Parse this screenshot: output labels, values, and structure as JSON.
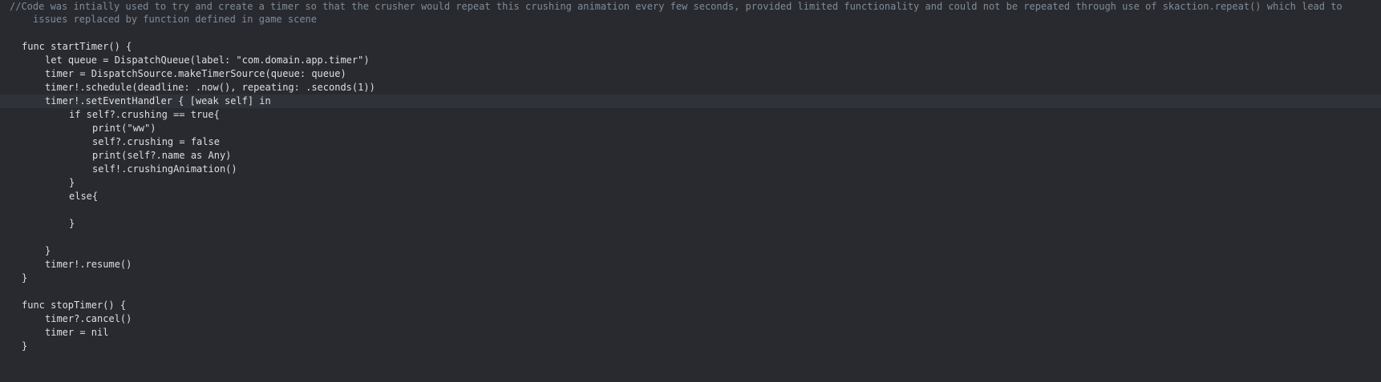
{
  "editor": {
    "lines": [
      {
        "text": "//Code was intially used to try and create a timer so that the crusher would repeat this crushing animation every few seconds, provided limited functionality and could not be repeated through use of skaction.repeat() which lead to"
      },
      {
        "text": "issues replaced by function defined in game scene"
      },
      {
        "text": ""
      },
      {
        "text": "func startTimer() {"
      },
      {
        "text": "let queue = DispatchQueue(label: \"com.domain.app.timer\")"
      },
      {
        "text": "timer = DispatchSource.makeTimerSource(queue: queue)"
      },
      {
        "text": "timer!.schedule(deadline: .now(), repeating: .seconds(1))"
      },
      {
        "text": "timer!.setEventHandler { [weak self] in"
      },
      {
        "text": "if self?.crushing == true{"
      },
      {
        "text": "print(\"ww\")"
      },
      {
        "text": "self?.crushing = false"
      },
      {
        "text": "print(self?.name as Any)"
      },
      {
        "text": "self!.crushingAnimation()"
      },
      {
        "text": "}"
      },
      {
        "text": "else{"
      },
      {
        "text": ""
      },
      {
        "text": "}"
      },
      {
        "text": ""
      },
      {
        "text": "}"
      },
      {
        "text": "timer!.resume()"
      },
      {
        "text": "}"
      },
      {
        "text": ""
      },
      {
        "text": "func stopTimer() {"
      },
      {
        "text": "timer?.cancel()"
      },
      {
        "text": "timer = nil"
      },
      {
        "text": "}"
      }
    ]
  }
}
